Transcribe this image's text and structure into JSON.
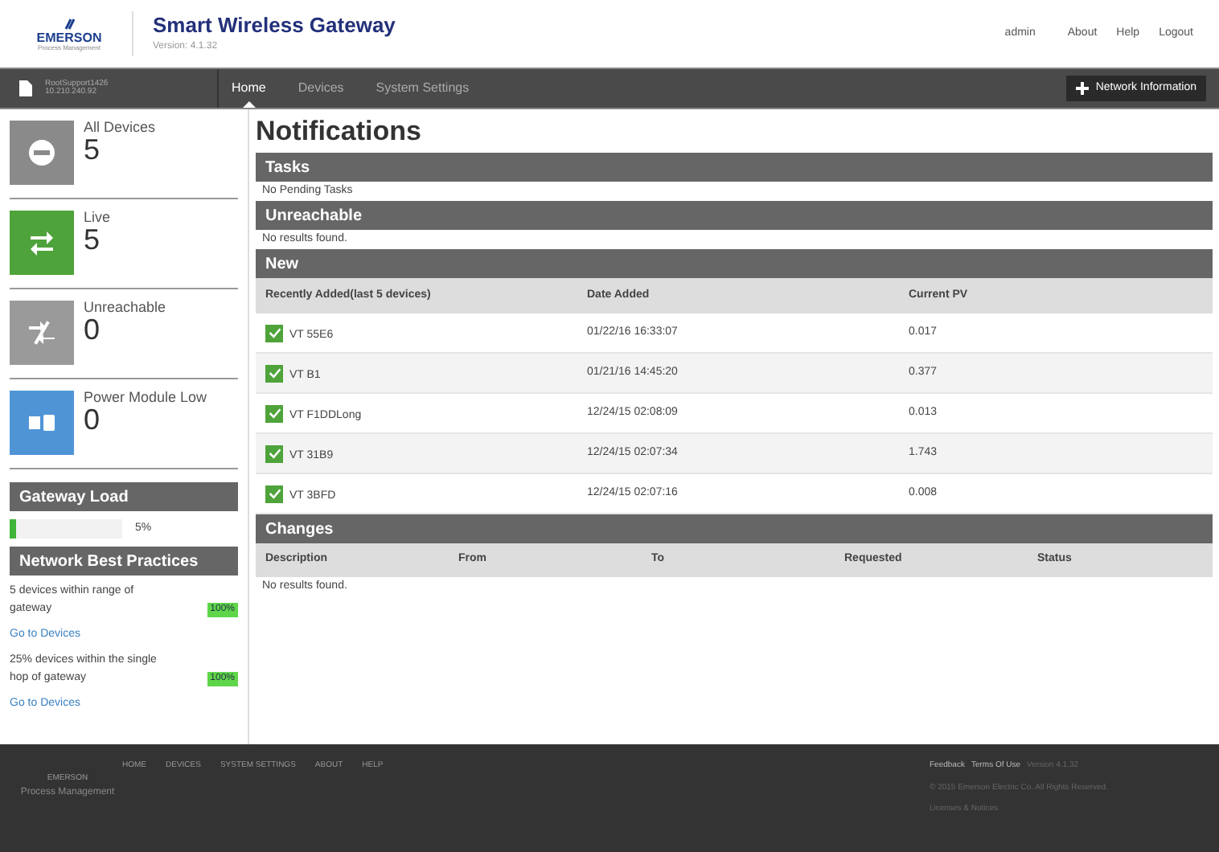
{
  "header": {
    "brand": "EMERSON",
    "brand_sub": "Process Management",
    "title": "Smart Wireless Gateway",
    "version": "Version: 4.1.32",
    "user": "admin",
    "links": [
      "About",
      "Help",
      "Logout"
    ]
  },
  "navbar": {
    "device_name": "RootSupport1426",
    "device_ip": "10.210.240.92",
    "tabs": [
      {
        "label": "Home",
        "selected": true
      },
      {
        "label": "Devices",
        "selected": false
      },
      {
        "label": "System Settings",
        "selected": false
      }
    ],
    "action": "Network Information"
  },
  "sidebar": {
    "stats": [
      {
        "kind": "all",
        "label": "All Devices",
        "count": "5",
        "color": "#8a8a8a"
      },
      {
        "kind": "live",
        "label": "Live",
        "count": "5",
        "color": "#4ea33a"
      },
      {
        "kind": "unreachable",
        "label": "Unreachable",
        "count": "0",
        "color": "#9a9a9a"
      },
      {
        "kind": "power",
        "label": "Power Module Low",
        "count": "0",
        "color": "#4f95d6"
      }
    ],
    "gateway_load": {
      "title": "Gateway Load",
      "level": 0.05,
      "reading": "5%"
    },
    "best_practices": {
      "title": "Network Best Practices",
      "items": [
        {
          "text": "5 devices within range of gateway",
          "badge": "100%",
          "link": "Go to Devices"
        },
        {
          "text": "25% devices within the single hop of gateway",
          "badge": "100%",
          "link": "Go to Devices"
        }
      ]
    }
  },
  "main": {
    "title": "Notifications",
    "tasks": {
      "title": "Tasks",
      "message": "No Pending Tasks"
    },
    "unreachable": {
      "title": "Unreachable",
      "message": "No results found."
    },
    "new": {
      "title": "New",
      "columns": [
        "Recently Added(last 5 devices)",
        "Date Added",
        "Current PV"
      ],
      "rows": [
        {
          "checked": true,
          "name": "VT 55E6",
          "date": "01/22/16 16:33:07",
          "pv": "0.017"
        },
        {
          "checked": true,
          "name": "VT B1",
          "date": "01/21/16 14:45:20",
          "pv": "0.377"
        },
        {
          "checked": true,
          "name": "VT F1DDLong",
          "date": "12/24/15 02:08:09",
          "pv": "0.013"
        },
        {
          "checked": true,
          "name": "VT 31B9",
          "date": "12/24/15 02:07:34",
          "pv": "1.743"
        },
        {
          "checked": true,
          "name": "VT 3BFD",
          "date": "12/24/15 02:07:16",
          "pv": "0.008"
        }
      ]
    },
    "changes": {
      "title": "Changes",
      "columns": [
        "Description",
        "From",
        "To",
        "Requested",
        "Status"
      ],
      "message": "No results found."
    }
  },
  "footer": {
    "brand": "EMERSON",
    "brand_sub": "Process Management",
    "links": [
      "HOME",
      "DEVICES",
      "SYSTEM SETTINGS",
      "ABOUT",
      "HELP"
    ],
    "feedback": "Feedback",
    "terms": "Terms Of Use",
    "version": "Version 4.1.32",
    "copyright": "© 2015 Emerson Electric Co. All Rights Reserved.",
    "licenses": "Licenses & Notices"
  }
}
